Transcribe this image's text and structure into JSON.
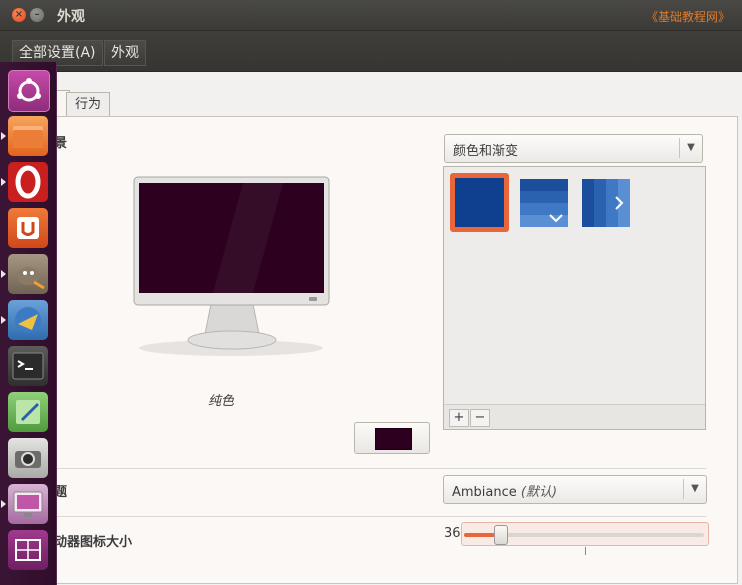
{
  "window": {
    "title": "外观",
    "watermark": "《基础教程网》"
  },
  "breadcrumb": {
    "all_settings": "全部设置(A)",
    "current": "外观"
  },
  "tabs": {
    "look_partial": "",
    "behavior": "行为"
  },
  "background": {
    "section_label_partial": "景",
    "dropdown_value": "颜色和渐变",
    "caption": "纯色",
    "color": "#2c001e",
    "selected_swatch_color": "#0f3f8f",
    "add_label": "+",
    "remove_label": "−"
  },
  "theme": {
    "section_label_partial": "题",
    "dropdown_value": "Ambiance",
    "dropdown_suffix": "(默认)"
  },
  "launcher_size": {
    "section_label_partial": "动器图标大小",
    "value": "36",
    "fraction": 0.15
  },
  "launcher_icons": [
    "ubuntu-dash-icon",
    "files-icon",
    "opera-icon",
    "ubuntu-software-icon",
    "gimp-icon",
    "thunderbird-icon",
    "terminal-icon",
    "text-editor-icon",
    "camera-icon",
    "system-settings-icon",
    "workspace-switcher-icon"
  ],
  "colors": {
    "accent": "#e9663a",
    "titlebar": "#3c3b37",
    "launcher": "#35102f"
  }
}
